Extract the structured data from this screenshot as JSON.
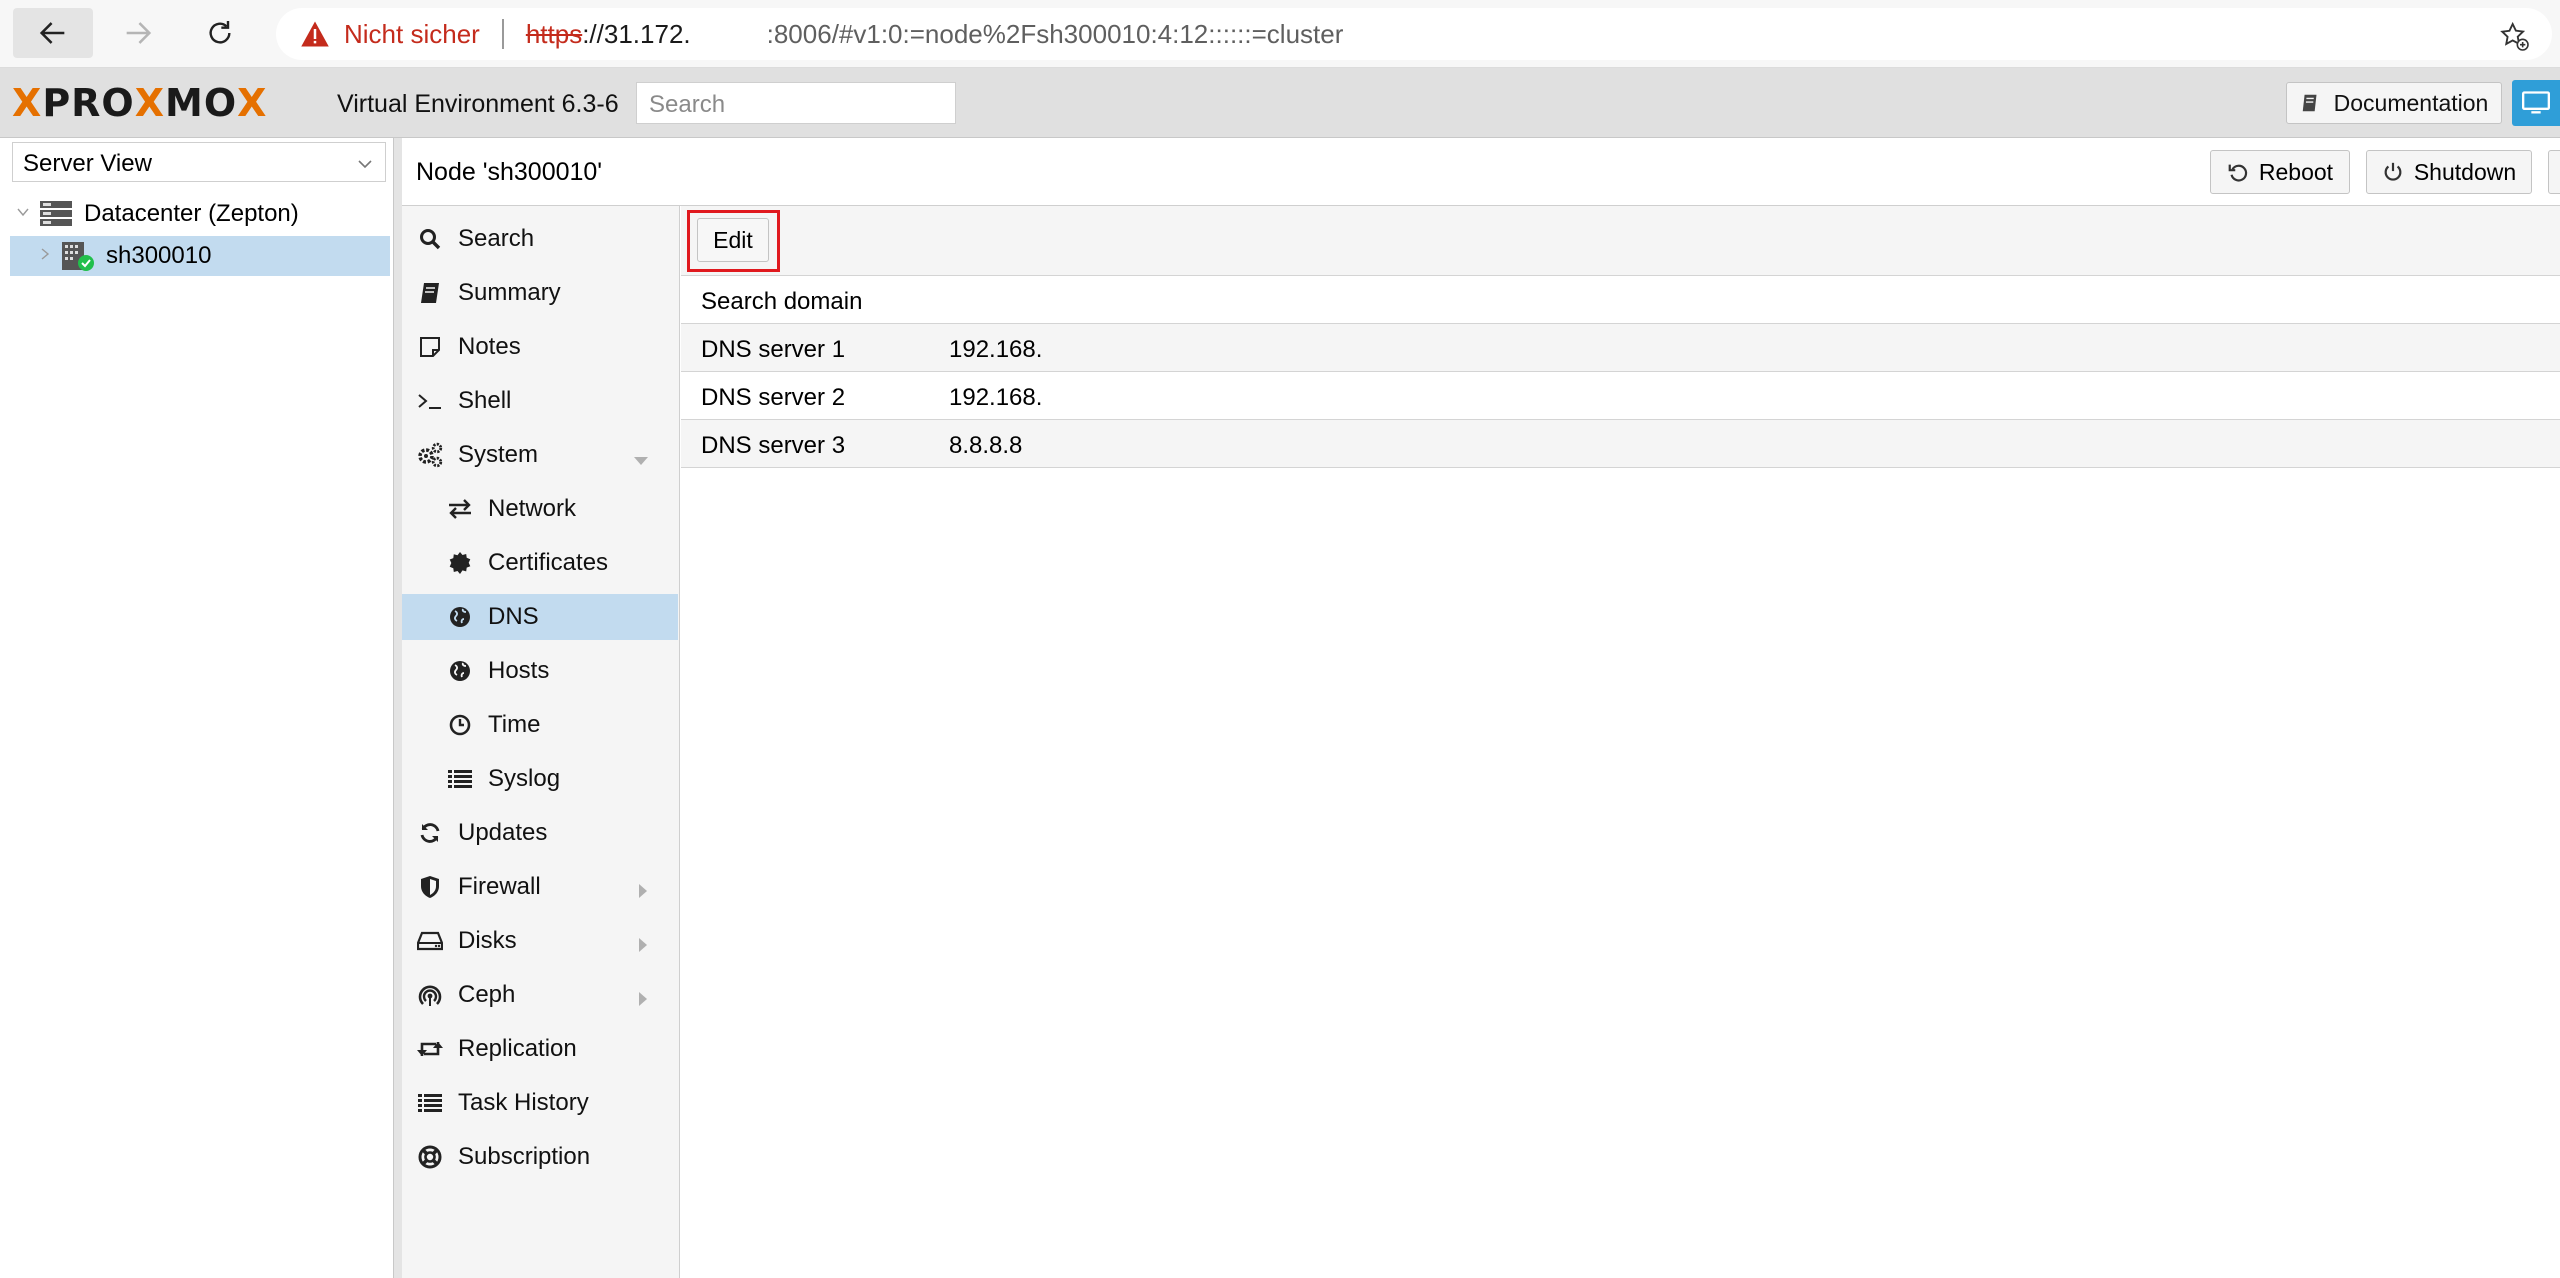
{
  "browser": {
    "security_label": "Nicht sicher",
    "url_protocol": "https",
    "url_host": "://31.172.",
    "url_rest": ":8006/#v1:0:=node%2Fsh300010:4:12::::::=cluster"
  },
  "header": {
    "logo_x": "X",
    "logo_pro": "PRO",
    "logo_x2": "X",
    "logo_mo": "MO",
    "logo_x3": "X",
    "version": "Virtual Environment 6.3-6",
    "search_placeholder": "Search",
    "documentation_label": "Documentation"
  },
  "tree": {
    "view_label": "Server View",
    "datacenter_label": "Datacenter (Zepton)",
    "node_label": "sh300010"
  },
  "content_header": {
    "title": "Node 'sh300010'",
    "reboot_label": "Reboot",
    "shutdown_label": "Shutdown"
  },
  "menu": {
    "search": "Search",
    "summary": "Summary",
    "notes": "Notes",
    "shell": "Shell",
    "system": "System",
    "network": "Network",
    "certificates": "Certificates",
    "dns": "DNS",
    "hosts": "Hosts",
    "time": "Time",
    "syslog": "Syslog",
    "updates": "Updates",
    "firewall": "Firewall",
    "disks": "Disks",
    "ceph": "Ceph",
    "replication": "Replication",
    "task_history": "Task History",
    "subscription": "Subscription"
  },
  "dns": {
    "edit_label": "Edit",
    "rows": [
      {
        "key": "Search domain",
        "value": ""
      },
      {
        "key": "DNS server 1",
        "value": "192.168."
      },
      {
        "key": "DNS server 2",
        "value": "192.168."
      },
      {
        "key": "DNS server 3",
        "value": "8.8.8.8"
      }
    ]
  },
  "colors": {
    "accent_orange": "#e57000",
    "selection_blue": "#c2dbef",
    "highlight_red": "#e0191e",
    "warning_red": "#c42b1c"
  }
}
